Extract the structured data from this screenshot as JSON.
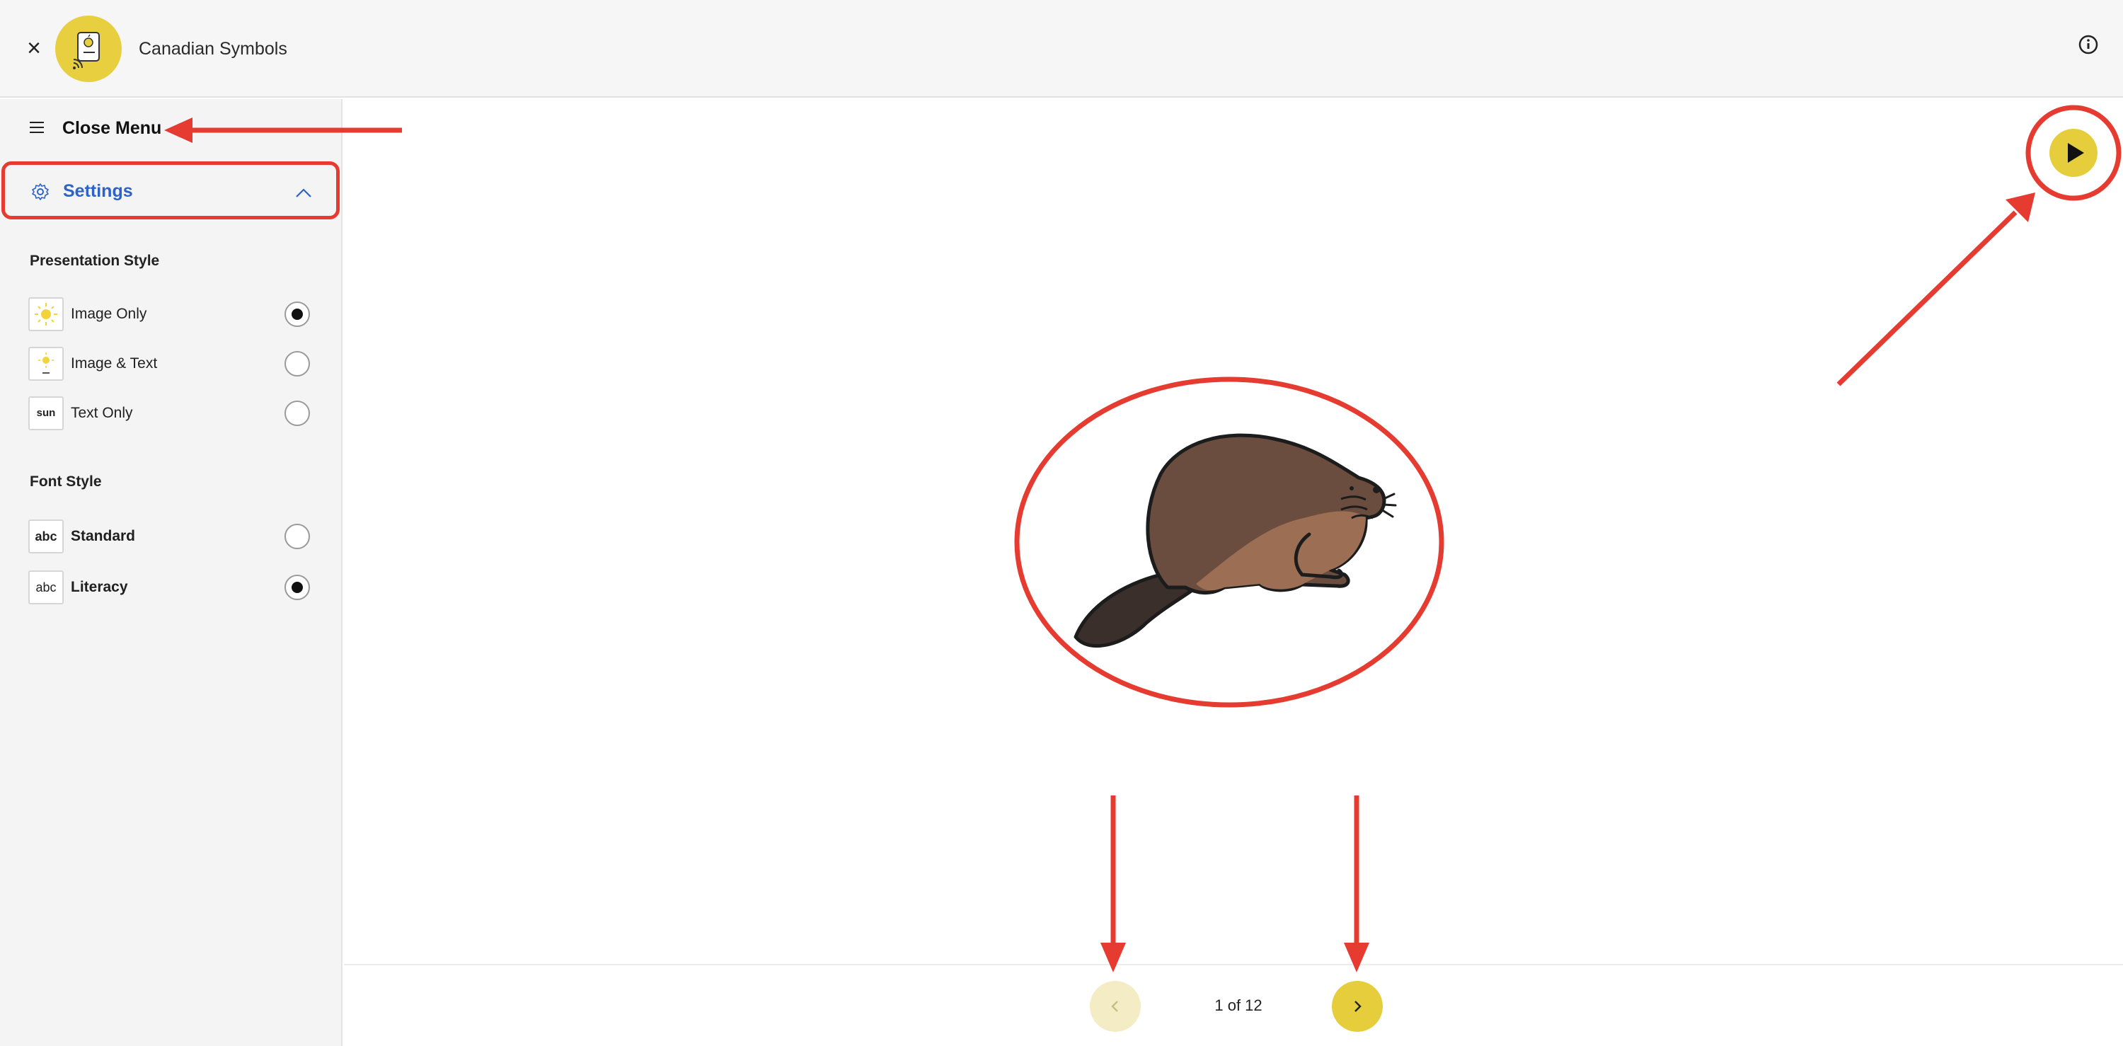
{
  "window": {
    "close_glyph": "×",
    "title": "Canadian Symbols"
  },
  "sidebar": {
    "menu_label": "Close Menu",
    "settings_label": "Settings",
    "presentation": {
      "heading": "Presentation Style",
      "options": [
        {
          "label": "Image Only",
          "selected": true
        },
        {
          "label": "Image & Text",
          "selected": false
        },
        {
          "label": "Text Only",
          "selected": false,
          "thumb_text": "sun"
        }
      ]
    },
    "font": {
      "heading": "Font Style",
      "options": [
        {
          "label": "Standard",
          "selected": false,
          "thumb_text": "abc"
        },
        {
          "label": "Literacy",
          "selected": true,
          "thumb_text": "abc"
        }
      ]
    }
  },
  "main": {
    "pager_text": "1 of 12"
  },
  "colors": {
    "accent_yellow": "#e6cd3c",
    "link_blue": "#2c62c9",
    "annotation_red": "#e53b31"
  },
  "icons": [
    "close-icon",
    "app-logo-icon",
    "info-icon",
    "hamburger-icon",
    "gear-icon",
    "chevron-up-icon",
    "sun-icon",
    "play-icon",
    "beaver-icon",
    "chevron-left-icon",
    "chevron-right-icon"
  ]
}
